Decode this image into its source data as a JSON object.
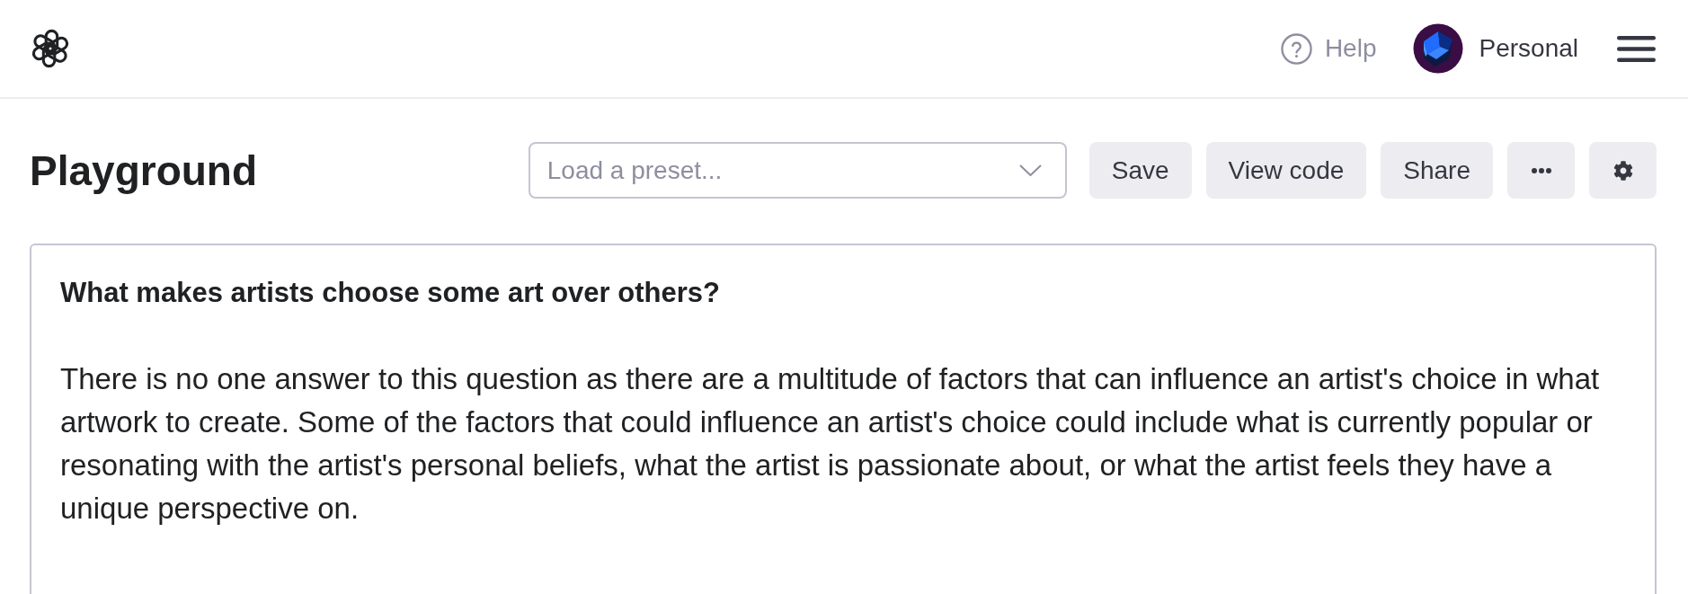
{
  "header": {
    "help": "Help",
    "account": "Personal"
  },
  "toolbar": {
    "title": "Playground",
    "preset": {
      "placeholder": "Load a preset..."
    },
    "buttons": [
      {
        "kind": "text",
        "label": "Save"
      },
      {
        "kind": "text",
        "label": "View code"
      },
      {
        "kind": "text",
        "label": "Share"
      },
      {
        "kind": "more"
      },
      {
        "kind": "settings"
      }
    ]
  },
  "editor": {
    "prompt": "What makes artists choose some art over others?",
    "completion": "There is no one answer to this question as there are a multitude of factors that can influence an artist's choice in what artwork to create. Some of the factors that could influence an artist's choice could include what is currently popular or resonating with the artist's personal beliefs, what the artist is passionate about, or what the artist feels they have a unique perspective on."
  }
}
